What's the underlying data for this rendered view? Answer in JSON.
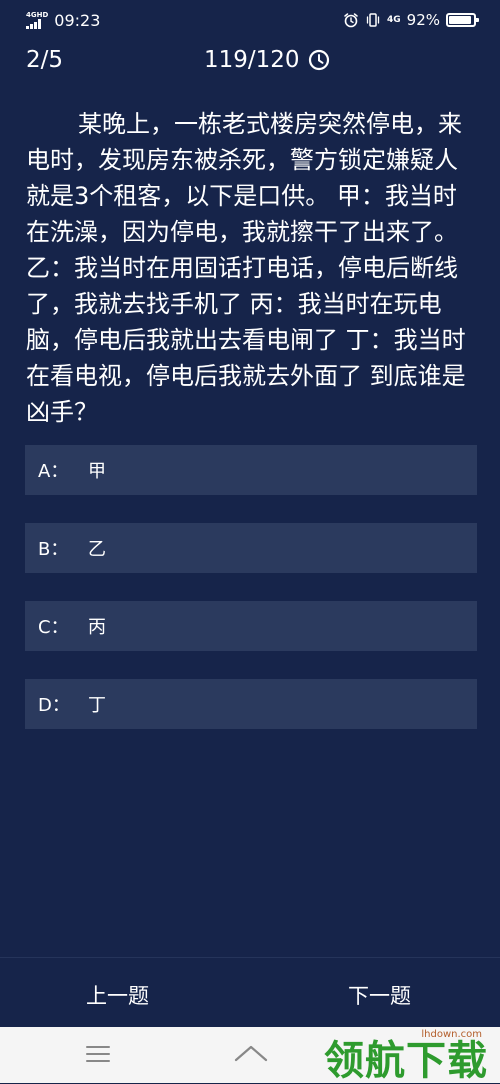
{
  "status_bar": {
    "network_label": "4GHD",
    "time": "09:23",
    "net_type": "4G",
    "battery_percent": "92%",
    "battery_level": 0.92,
    "icons": [
      "signal-icon",
      "alarm-icon",
      "vibrate-icon",
      "battery-icon"
    ]
  },
  "header": {
    "progress": "2/5",
    "timer": "119/120",
    "timer_icon": "clock-icon"
  },
  "question": {
    "text": "某晚上，一栋老式楼房突然停电，来电时，发现房东被杀死，警方锁定嫌疑人就是3个租客，以下是口供。 甲：我当时在洗澡，因为停电，我就擦干了出来了。 乙：我当时在用固话打电话，停电后断线了，我就去找手机了 丙：我当时在玩电脑，停电后我就出去看电闸了 丁：我当时在看电视，停电后我就去外面了 到底谁是凶手？"
  },
  "options": [
    {
      "letter": "A：",
      "text": "甲"
    },
    {
      "letter": "B：",
      "text": "乙"
    },
    {
      "letter": "C：",
      "text": "丙"
    },
    {
      "letter": "D：",
      "text": "丁"
    }
  ],
  "nav": {
    "prev_label": "上一题",
    "next_label": "下一题"
  },
  "system_nav": {
    "icons": [
      "menu-icon",
      "home-icon"
    ]
  },
  "watermark": {
    "url": "lhdown.com",
    "text": "领航下载"
  },
  "colors": {
    "background": "#16244a",
    "option_background": "#2b3a5e",
    "text": "#ffffff",
    "system_nav_background": "#f5f5f5",
    "watermark_green": "#2e9b2e"
  }
}
